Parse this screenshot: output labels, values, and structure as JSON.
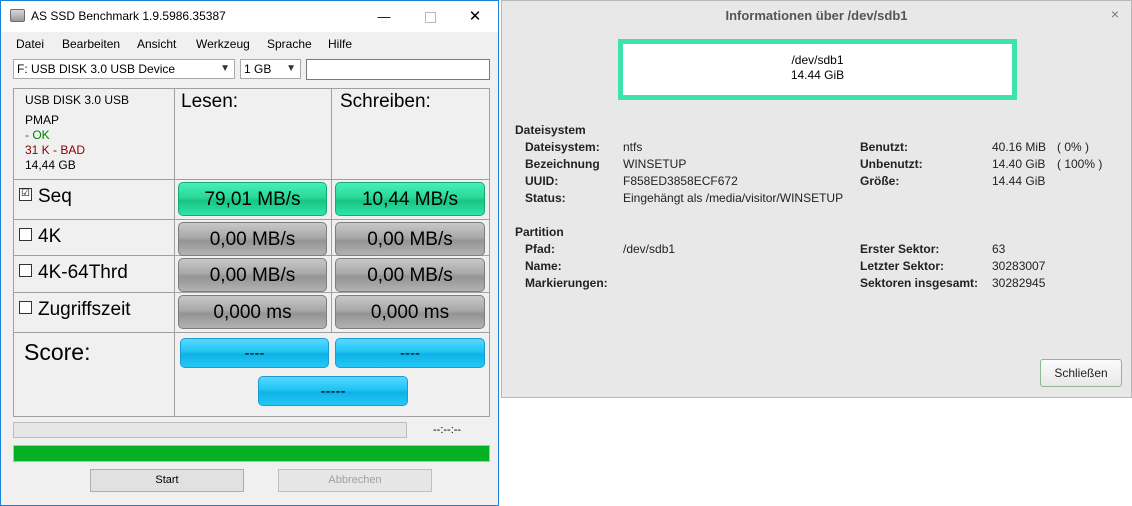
{
  "ssd": {
    "title": "AS SSD Benchmark 1.9.5986.35387",
    "window_controls": {
      "minimize": "—",
      "close": "✕"
    },
    "menu": [
      "Datei",
      "Bearbeiten",
      "Ansicht",
      "Werkzeug",
      "Sprache",
      "Hilfe"
    ],
    "drive_select": "F: USB DISK 3.0 USB Device",
    "size_select": "1 GB",
    "drive_info": {
      "name": "USB DISK 3.0 USB",
      "pmap": "PMAP",
      "ok": " - OK",
      "bad": "31 K - BAD",
      "size": "14,44 GB"
    },
    "headers": {
      "read": "Lesen:",
      "write": "Schreiben:"
    },
    "rows": [
      {
        "label": "Seq",
        "checked": true,
        "read": "79,01 MB/s",
        "write": "10,44 MB/s"
      },
      {
        "label": "4K",
        "checked": false,
        "read": "0,00 MB/s",
        "write": "0,00 MB/s"
      },
      {
        "label": "4K-64Thrd",
        "checked": false,
        "read": "0,00 MB/s",
        "write": "0,00 MB/s"
      },
      {
        "label": "Zugriffszeit",
        "checked": false,
        "read": "0,000 ms",
        "write": "0,000 ms"
      }
    ],
    "check_marks": {
      "checked": "☑",
      "unchecked": "☐"
    },
    "score": {
      "label": "Score:",
      "read": "----",
      "write": "----",
      "total": "-----"
    },
    "time": "--:--:--",
    "progress_bottom": 1.0,
    "buttons": {
      "start": "Start",
      "cancel": "Abbrechen"
    },
    "colors": {
      "green": "#2ad898",
      "gray": "#a8a8a8",
      "blue": "#1ec4f4",
      "progress": "#06b025"
    }
  },
  "info": {
    "title": "Informationen über /dev/sdb1",
    "close_glyph": "×",
    "device": "/dev/sdb1",
    "device_size": "14.44 GiB",
    "filesystem": {
      "heading": "Dateisystem",
      "left": [
        {
          "label": "Dateisystem:",
          "value": "ntfs"
        },
        {
          "label": "Bezeichnung",
          "value": "WINSETUP"
        },
        {
          "label": "UUID:",
          "value": "F858ED3858ECF672"
        },
        {
          "label": "Status:",
          "value": "Eingehängt als /media/visitor/WINSETUP"
        }
      ],
      "right": [
        {
          "label": "Benutzt:",
          "value": "40.16 MiB",
          "extra": "( 0% )"
        },
        {
          "label": "Unbenutzt:",
          "value": "14.40 GiB",
          "extra": "( 100% )"
        },
        {
          "label": "Größe:",
          "value": "14.44 GiB",
          "extra": ""
        }
      ]
    },
    "partition": {
      "heading": "Partition",
      "left": [
        {
          "label": "Pfad:",
          "value": "/dev/sdb1"
        },
        {
          "label": "Name:",
          "value": ""
        },
        {
          "label": "Markierungen:",
          "value": ""
        }
      ],
      "right": [
        {
          "label": "Erster Sektor:",
          "value": "63"
        },
        {
          "label": "Letzter Sektor:",
          "value": "30283007"
        },
        {
          "label": "Sektoren insgesamt:",
          "value": "30282945"
        }
      ]
    },
    "close_button": "Schließen",
    "accent": "#3de3a7"
  }
}
